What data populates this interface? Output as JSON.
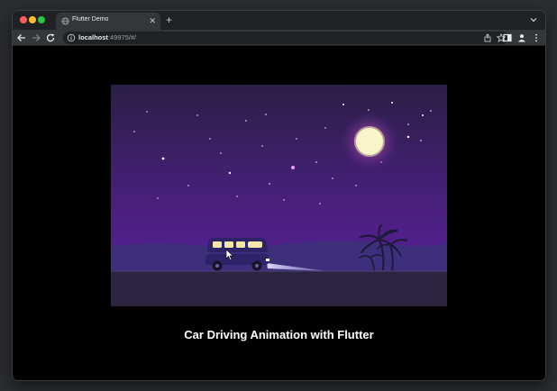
{
  "browser": {
    "tab": {
      "title": "Flutter Demo",
      "favicon": "globe-icon",
      "close_glyph": "✕"
    },
    "new_tab_glyph": "+",
    "url_host": "localhost",
    "url_rest": ":49975/#/"
  },
  "page": {
    "caption": "Car Driving Animation with Flutter"
  },
  "colors": {
    "sky_top": "#2a1f45",
    "sky_bottom": "#5d22a0",
    "ground": "#2d2442",
    "moon": "#f8f5c8",
    "van": "#2e2368",
    "headlight": "#c9c4e8"
  }
}
